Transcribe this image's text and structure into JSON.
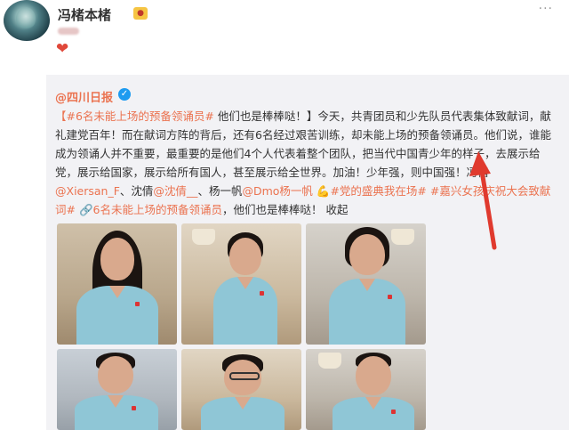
{
  "header": {
    "username": "冯楮本楮",
    "more": "···"
  },
  "repost": {
    "source": "@四川日报",
    "text": {
      "hashtag1": "【#6名未能上场的预备领诵员#",
      "line1_rest": " 他们也是棒棒哒！】今天，共青团员和少先队员代表集体致献词，献礼建党百年！而在献词方阵的背后，还有6名经过艰苦训练，却未能上场的预备领诵员。他们说，谁能成为领诵人并不重要，最重要的是他们4个人代表着整个团队，把当代中国青少年的样子，去展示给党，展示给国家，展示给所有国人，甚至展示给全世界。加油！少年强，则中国强！冯楮",
      "mention1": "@Xiersan_F",
      "sep1": "、沈倩",
      "mention2": "@沈倩__",
      "sep2": "、杨一帆",
      "mention3": "@Dmo杨一帆",
      "tag2": " 💪#党的盛典我在场#",
      "tag3": " #嘉兴女孩庆祝大会致献词#",
      "tag4": " 🔗6名未能上场的预备领诵员",
      "tail": "，他们也是棒棒哒！ 收起"
    }
  },
  "colors": {
    "accent": "#eb7350",
    "shirt": "#8fc6d6",
    "arrow": "#e03a2e"
  }
}
